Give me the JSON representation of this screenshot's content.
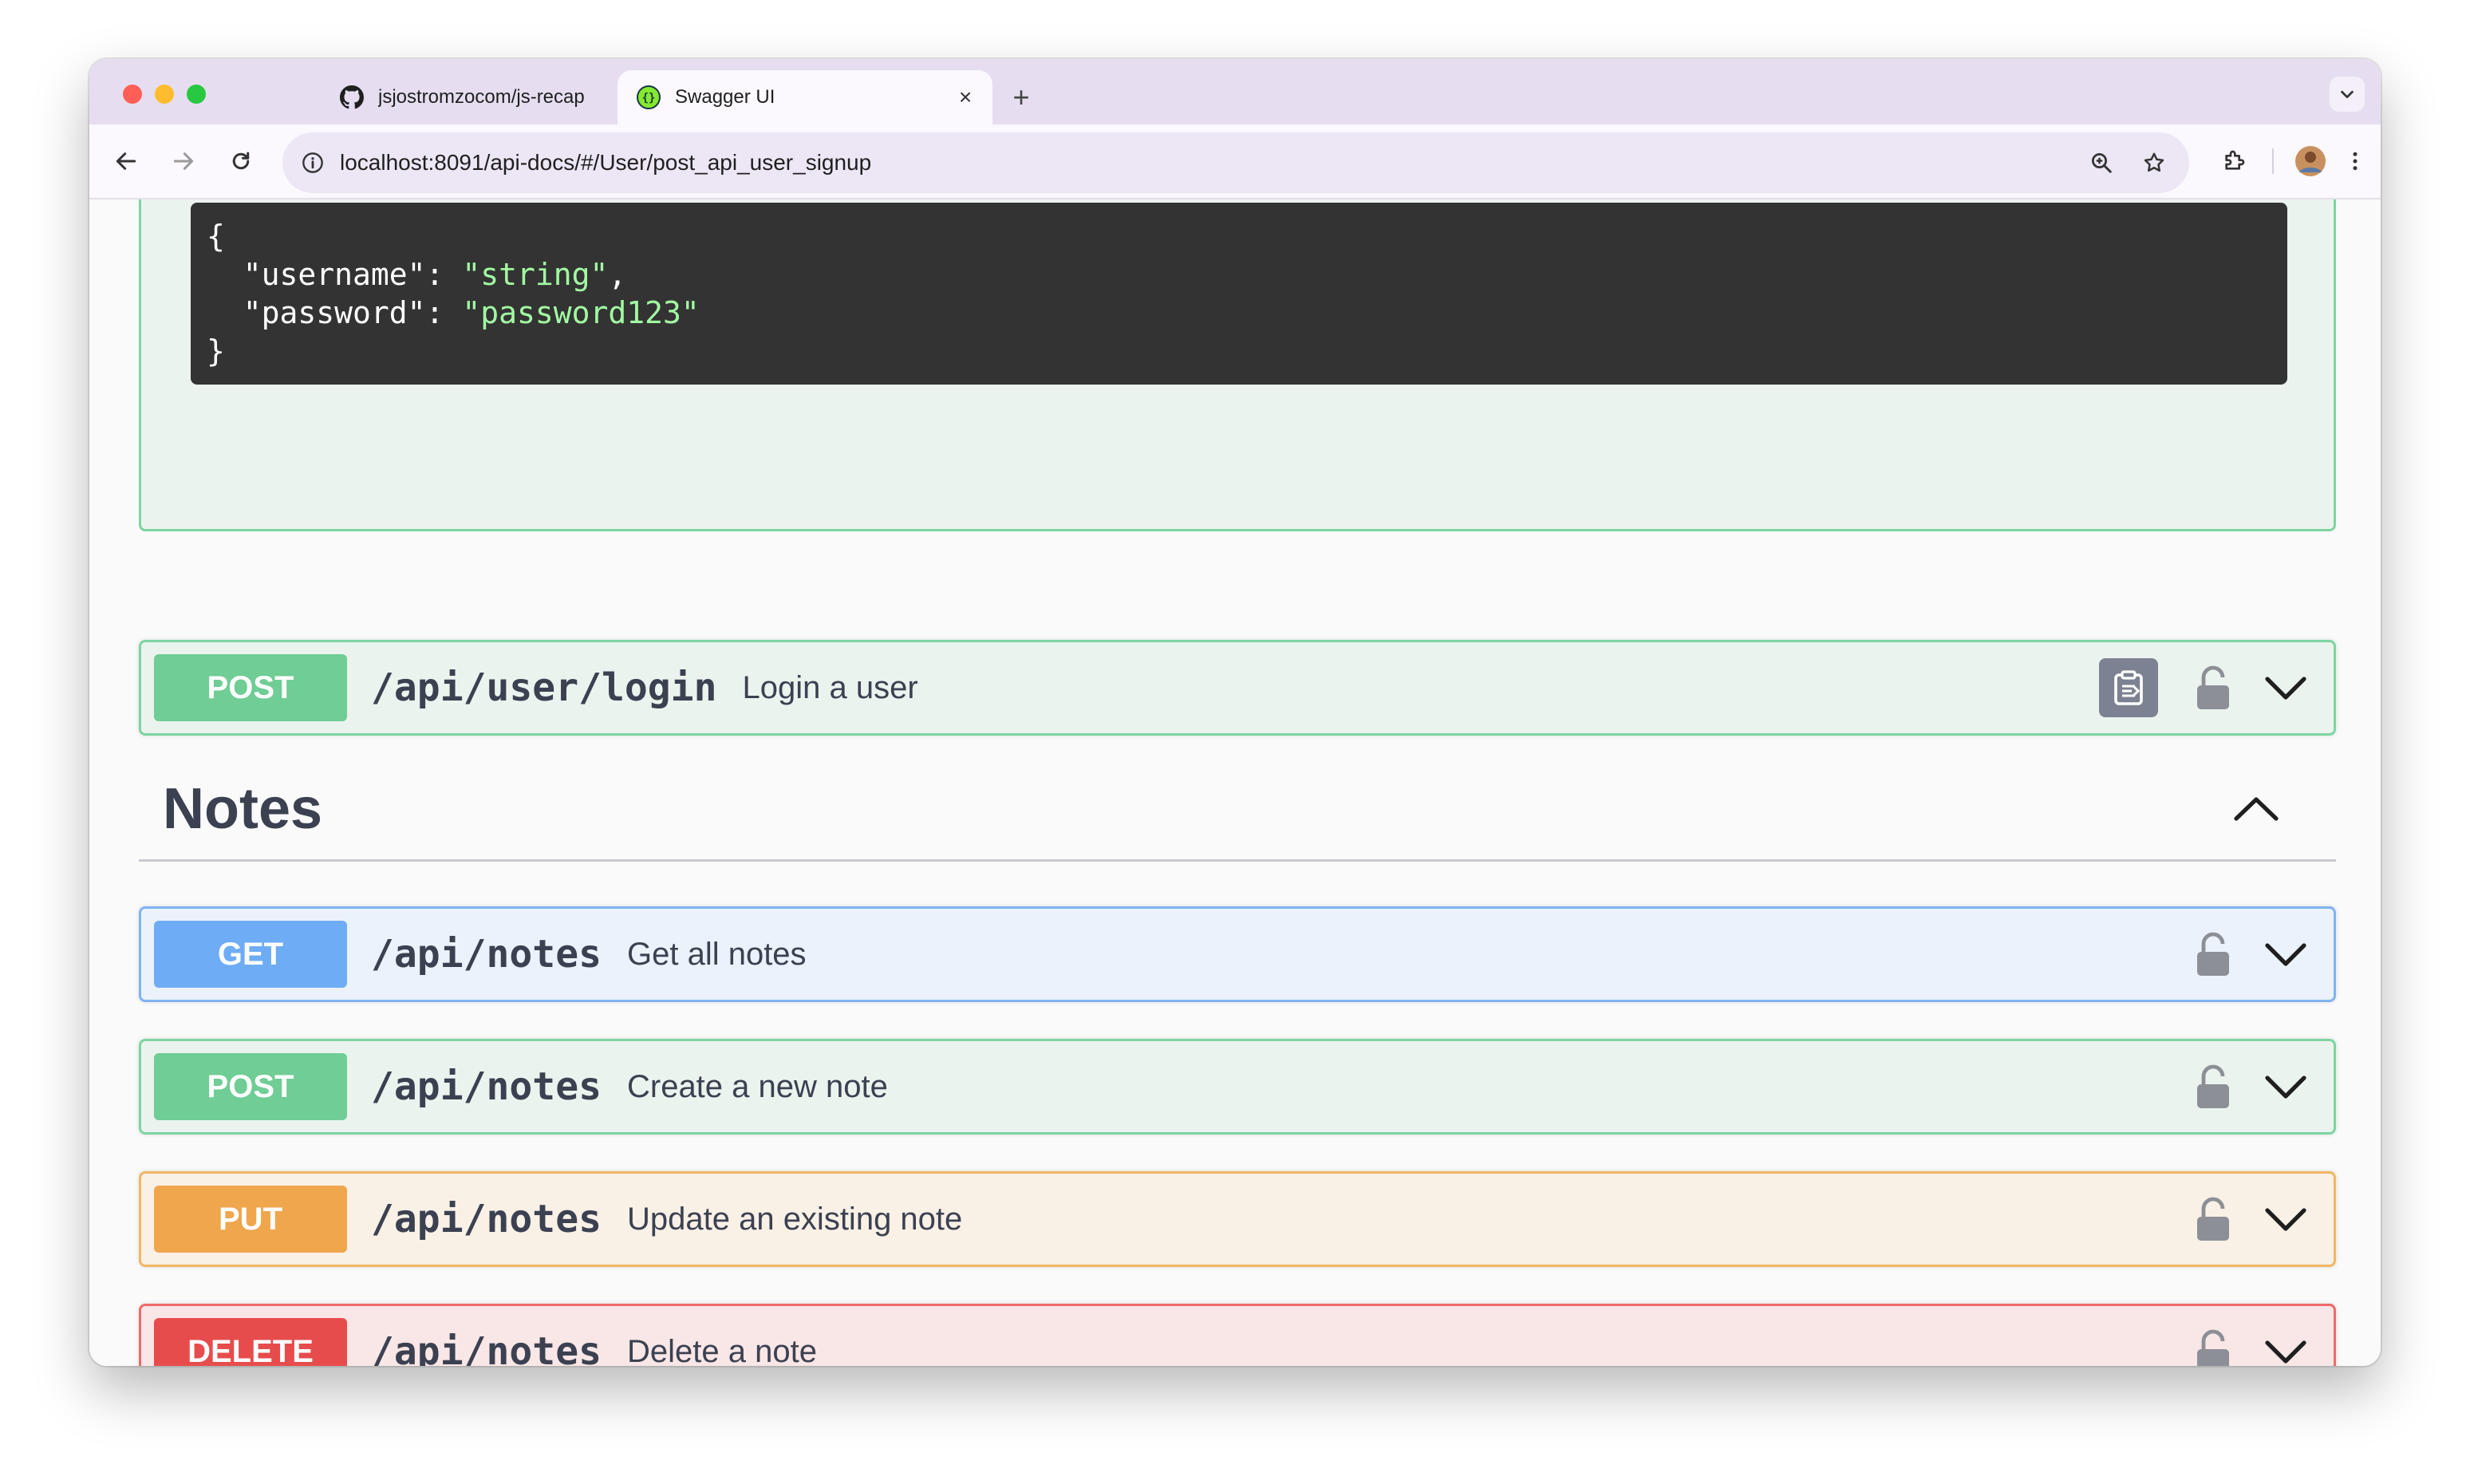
{
  "browser": {
    "tabs": [
      {
        "title": "jsjostromzocom/js-recap",
        "favicon": "github-icon",
        "active": false
      },
      {
        "title": "Swagger UI",
        "favicon": "swagger-icon",
        "active": true
      }
    ],
    "url": "localhost:8091/api-docs/#/User/post_api_user_signup"
  },
  "request_example": {
    "open_brace": "{",
    "lines": [
      {
        "key": "\"username\"",
        "value": "\"string\"",
        "trailing": ","
      },
      {
        "key": "\"password\"",
        "value": "\"password123\"",
        "trailing": ""
      }
    ],
    "close_brace": "}"
  },
  "login_operation": {
    "method": "POST",
    "path": "/api/user/login",
    "summary": "Login a user"
  },
  "notes_section": {
    "title": "Notes",
    "operations": [
      {
        "method": "GET",
        "path": "/api/notes",
        "summary": "Get all notes",
        "type": "get"
      },
      {
        "method": "POST",
        "path": "/api/notes",
        "summary": "Create a new note",
        "type": "post"
      },
      {
        "method": "PUT",
        "path": "/api/notes",
        "summary": "Update an existing note",
        "type": "put"
      },
      {
        "method": "DELETE",
        "path": "/api/notes",
        "summary": "Delete a note",
        "type": "delete"
      }
    ]
  },
  "colors": {
    "post": "#49cc90",
    "get": "#61affe",
    "put": "#fca130",
    "delete": "#f93e3e",
    "text": "#3b4151",
    "code_bg": "#333333",
    "code_string": "#a2fca2"
  }
}
